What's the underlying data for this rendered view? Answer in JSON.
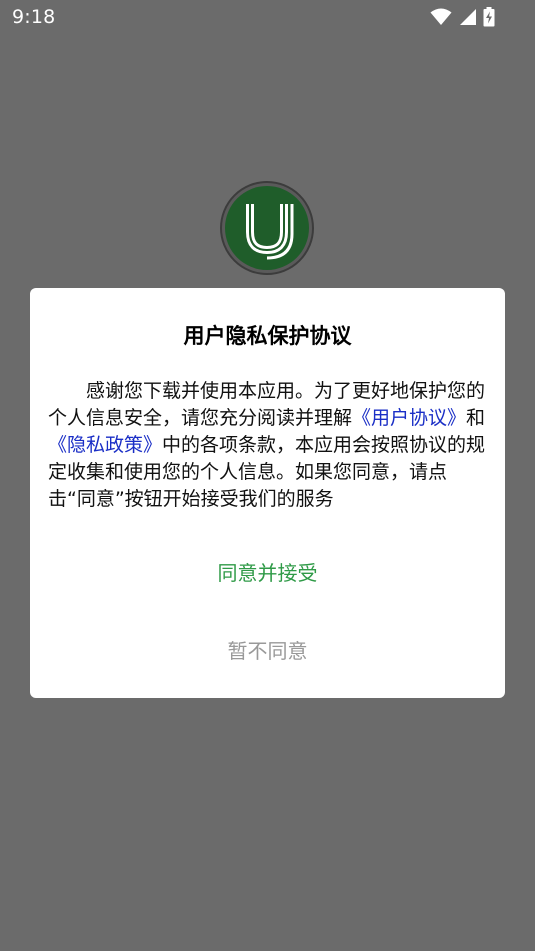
{
  "status_bar": {
    "time": "9:18",
    "icons": [
      "wifi-icon",
      "signal-icon",
      "battery-charging-icon"
    ]
  },
  "app_logo": {
    "icon": "u-logo-icon",
    "color": "#1f5d2a"
  },
  "dialog": {
    "title": "用户隐私保护协议",
    "body": {
      "intro": "感谢您下载并使用本应用。为了更好地保护您的个人信息安全，请您充分阅读并理解",
      "link_user_agreement": "《用户协议》",
      "conjunction": "和",
      "link_privacy_policy": "《隐私政策》",
      "rest": "中的各项条款，本应用会按照协议的规定收集和使用您的个人信息。如果您同意，请点击“同意”按钮开始接受我们的服务"
    },
    "agree_label": "同意并接受",
    "decline_label": "暂不同意",
    "agree_color": "#2f9a47",
    "link_color": "#1a2ec6"
  }
}
